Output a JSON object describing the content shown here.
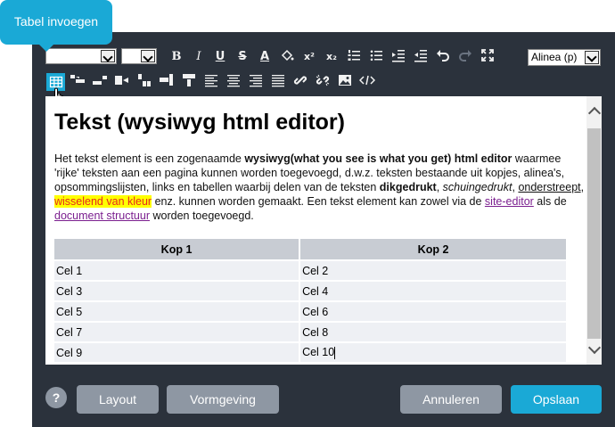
{
  "tooltip": "Tabel invoegen",
  "toolbar1": {
    "font_value": "",
    "size_value": "",
    "bold": "B",
    "italic": "I",
    "underline": "U",
    "strike": "S",
    "fontcolor": "A",
    "superscript": "x²",
    "subscript": "x₂",
    "paragraph_format": "Alinea (p)"
  },
  "editor": {
    "heading": "Tekst (wysiwyg html editor)",
    "paragraph": {
      "t1": "Het tekst element is een zogenaamde ",
      "b1": "wysiwyg(what you see is what you get) html editor",
      "t2": " waarmee 'rijke' teksten aan een pagina kunnen worden toegevoegd, d.w.z. teksten bestaande uit kopjes, alinea's, opsommingslijsten, links en tabellen waarbij delen van de teksten ",
      "b2": "dikgedrukt",
      "t3": ", ",
      "i1": "schuingedrukt",
      "t4": ", ",
      "u1": "onderstreept",
      "t5": ", ",
      "hl": "wisselend van kleur",
      "t6": " enz. kunnen worden gemaakt. Een tekst element kan zowel via de ",
      "link1": "site-editor",
      "t7": " als de ",
      "link2": "document structuur",
      "t8": " worden toegevoegd."
    },
    "table": {
      "headers": [
        "Kop 1",
        "Kop 2"
      ],
      "rows": [
        [
          "Cel 1",
          "Cel 2"
        ],
        [
          "Cel 3",
          "Cel 4"
        ],
        [
          "Cel 5",
          "Cel 6"
        ],
        [
          "Cel 7",
          "Cel 8"
        ],
        [
          "Cel 9",
          "Cel 10"
        ]
      ]
    }
  },
  "footer": {
    "help": "?",
    "layout": "Layout",
    "vormgeving": "Vormgeving",
    "annuleren": "Annuleren",
    "opslaan": "Opslaan"
  },
  "colors": {
    "accent": "#1aa9d6",
    "frame": "#2b323c",
    "button": "#8e97a3",
    "highlight_bg": "#ffff00",
    "highlight_text": "#e6291c",
    "link": "#7b1f8f"
  }
}
